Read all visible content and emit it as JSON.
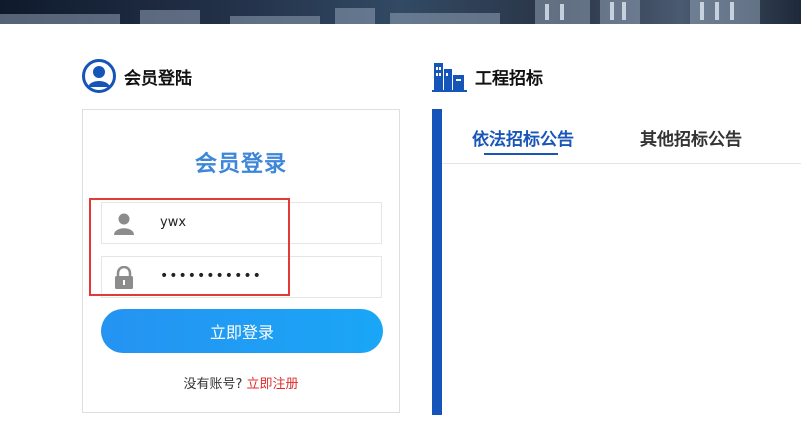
{
  "member_section": {
    "title": "会员登陆"
  },
  "bid_section": {
    "title": "工程招标"
  },
  "login": {
    "heading": "会员登录",
    "username_value": "ywx",
    "password_value": "•••••••••••",
    "submit_label": "立即登录",
    "no_account_text": "没有账号?",
    "register_link": "立即注册"
  },
  "bid_tabs": [
    {
      "label": "依法招标公告",
      "active": true
    },
    {
      "label": "其他招标公告",
      "active": false
    }
  ],
  "colors": {
    "accent_blue": "#1554b8",
    "login_title": "#3d86d8",
    "button_gradient_start": "#2593f2",
    "button_gradient_end": "#1aa6f6",
    "link_red": "#e02b2b",
    "highlight_red": "#e53935"
  },
  "icons": {
    "member": "user-circle-icon",
    "bid": "buildings-icon",
    "username": "user-icon",
    "password": "lock-icon"
  }
}
